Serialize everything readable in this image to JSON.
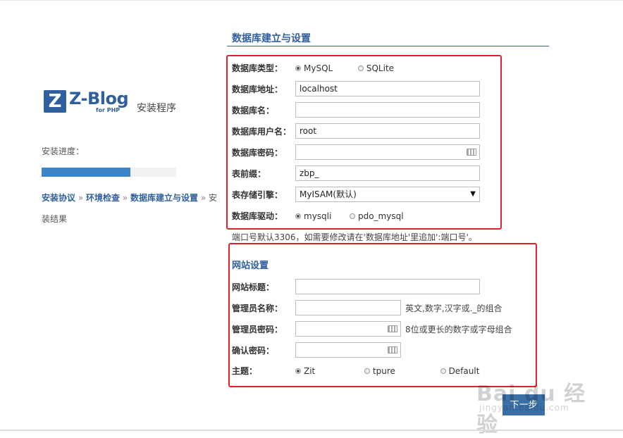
{
  "branding": {
    "logo_letter": "Z",
    "logo_text": "Z-Blog",
    "logo_sub": "for PHP",
    "install_title": "安装程序"
  },
  "progress": {
    "label": "安装进度：",
    "fraction": 0.66
  },
  "steps": {
    "items": [
      "安装协议",
      "环境检查",
      "数据库建立与设置"
    ],
    "separator": "»",
    "last_prefix": "安",
    "last_suffix": "装结果"
  },
  "db_section": {
    "title": "数据库建立与设置",
    "type_label": "数据库类型：",
    "type_options": [
      "MySQL",
      "SQLite"
    ],
    "type_selected": "MySQL",
    "host_label": "数据库地址：",
    "host_value": "localhost",
    "name_label": "数据库名：",
    "name_value": "",
    "user_label": "数据库用户名：",
    "user_value": "root",
    "password_label": "数据库密码：",
    "password_value": "",
    "prefix_label": "表前缀：",
    "prefix_value": "zbp_",
    "engine_label": "表存储引擎：",
    "engine_value": "MyISAM(默认)",
    "driver_label": "数据库驱动：",
    "driver_options": [
      "mysqli",
      "pdo_mysql"
    ],
    "driver_selected": "mysqli",
    "port_note": "端口号默认3306，如需要修改请在'数据库地址'里追加':端口号'。"
  },
  "site_section": {
    "title": "网站设置",
    "site_title_label": "网站标题：",
    "site_title_value": "",
    "admin_name_label": "管理员名称：",
    "admin_name_value": "",
    "admin_name_hint": "英文,数字,汉字或._的组合",
    "admin_password_label": "管理员密码：",
    "admin_password_value": "",
    "admin_password_hint": "8位或更长的数字或字母组合",
    "confirm_password_label": "确认密码：",
    "confirm_password_value": "",
    "theme_label": "主题：",
    "theme_options": [
      "Zit",
      "tpure",
      "Default"
    ],
    "theme_selected": "Zit"
  },
  "actions": {
    "next_label": "下一步"
  },
  "watermark": {
    "line1": "Bai du 经验",
    "line2": "jingyan.baidu.com"
  },
  "colors": {
    "brand_blue": "#2f5f9e",
    "progress_blue": "#3a85c8",
    "highlight_red": "#e0202a",
    "button_blue": "#3b6fa8"
  }
}
